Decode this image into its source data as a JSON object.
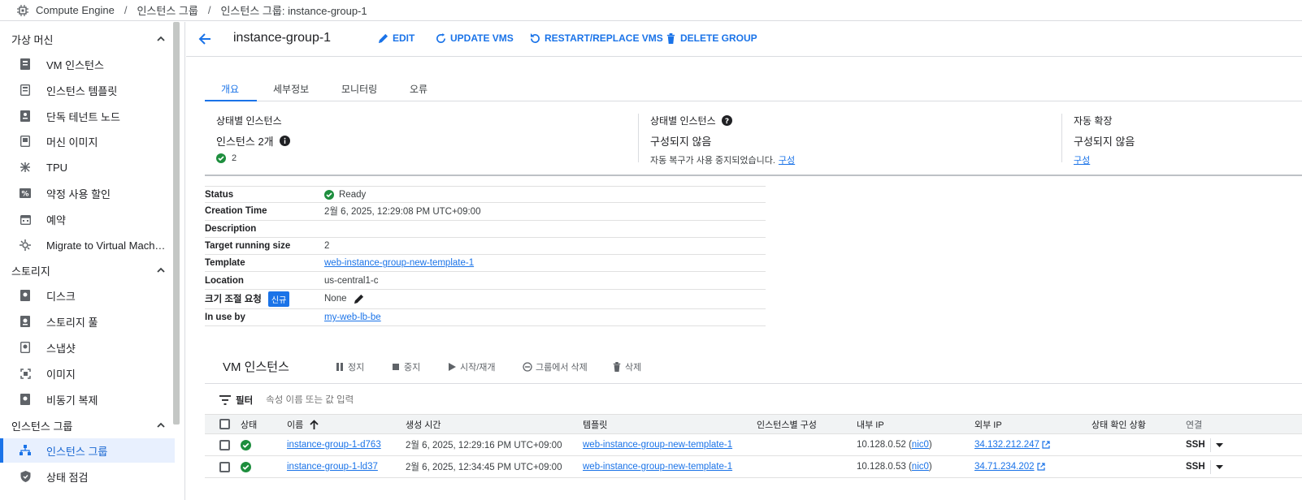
{
  "breadcrumb": {
    "items": [
      "Compute Engine",
      "인스턴스 그룹",
      "인스턴스 그룹: instance-group-1"
    ],
    "separator": "/"
  },
  "sidebar": {
    "sections": [
      {
        "title": "가상 머신",
        "items": [
          {
            "label": "VM 인스턴스",
            "icon": "vm-icon"
          },
          {
            "label": "인스턴스 템플릿",
            "icon": "template-icon"
          },
          {
            "label": "단독 테넌트 노드",
            "icon": "node-icon"
          },
          {
            "label": "머신 이미지",
            "icon": "machine-image-icon"
          },
          {
            "label": "TPU",
            "icon": "tpu-icon"
          },
          {
            "label": "약정 사용 할인",
            "icon": "percent-icon"
          },
          {
            "label": "예약",
            "icon": "calendar-icon"
          },
          {
            "label": "Migrate to Virtual Mach…",
            "icon": "migrate-icon"
          }
        ]
      },
      {
        "title": "스토리지",
        "items": [
          {
            "label": "디스크",
            "icon": "disk-icon"
          },
          {
            "label": "스토리지 풀",
            "icon": "storage-pool-icon"
          },
          {
            "label": "스냅샷",
            "icon": "snapshot-icon"
          },
          {
            "label": "이미지",
            "icon": "image-icon"
          },
          {
            "label": "비동기 복제",
            "icon": "replication-icon"
          }
        ]
      },
      {
        "title": "인스턴스 그룹",
        "items": [
          {
            "label": "인스턴스 그룹",
            "icon": "instance-group-icon",
            "active": true
          },
          {
            "label": "상태 점검",
            "icon": "health-check-icon"
          }
        ]
      }
    ]
  },
  "header": {
    "title": "instance-group-1",
    "actions": [
      "EDIT",
      "UPDATE VMS",
      "RESTART/REPLACE VMS",
      "DELETE GROUP"
    ]
  },
  "tabs": [
    "개요",
    "세부정보",
    "모니터링",
    "오류"
  ],
  "summary": {
    "card1": {
      "label": "상태별 인스턴스",
      "value": "인스턴스 2개",
      "count": "2"
    },
    "card2": {
      "label": "상태별 인스턴스",
      "value": "구성되지 않음",
      "note": "자동 복구가 사용 중지되었습니다.",
      "link": "구성"
    },
    "card3": {
      "label": "자동 확장",
      "value": "구성되지 않음",
      "link": "구성"
    }
  },
  "details": {
    "status": {
      "k": "Status",
      "v": "Ready"
    },
    "creation": {
      "k": "Creation Time",
      "v": "2월 6, 2025, 12:29:08 PM UTC+09:00"
    },
    "description": {
      "k": "Description",
      "v": ""
    },
    "target": {
      "k": "Target running size",
      "v": "2"
    },
    "template": {
      "k": "Template",
      "v": "web-instance-group-new-template-1"
    },
    "location": {
      "k": "Location",
      "v": "us-central1-c"
    },
    "resize": {
      "k": "크기 조절 요청",
      "badge": "신규",
      "v": "None"
    },
    "inuse": {
      "k": "In use by",
      "v": "my-web-lb-be"
    }
  },
  "vm": {
    "title": "VM 인스턴스",
    "actions": [
      "정지",
      "중지",
      "시작/재개",
      "그룹에서 삭제",
      "삭제"
    ],
    "filter_label": "필터",
    "filter_placeholder": "속성 이름 또는 값 입력",
    "columns": [
      "상태",
      "이름",
      "생성 시간",
      "템플릿",
      "인스턴스별 구성",
      "내부 IP",
      "외부 IP",
      "상태 확인 상황",
      "연결"
    ],
    "rows": [
      {
        "name": "instance-group-1-d763",
        "created": "2월 6, 2025, 12:29:16 PM UTC+09:00",
        "template": "web-instance-group-new-template-1",
        "internal_ip": "10.128.0.52",
        "nic": "nic0",
        "external_ip": "34.132.212.247",
        "connect": "SSH"
      },
      {
        "name": "instance-group-1-ld37",
        "created": "2월 6, 2025, 12:34:45 PM UTC+09:00",
        "template": "web-instance-group-new-template-1",
        "internal_ip": "10.128.0.53",
        "nic": "nic0",
        "external_ip": "34.71.234.202",
        "connect": "SSH"
      }
    ]
  },
  "colors": {
    "accent": "#1a73e8",
    "success": "#1e8e3e",
    "active_bg": "#e8f0fe"
  }
}
